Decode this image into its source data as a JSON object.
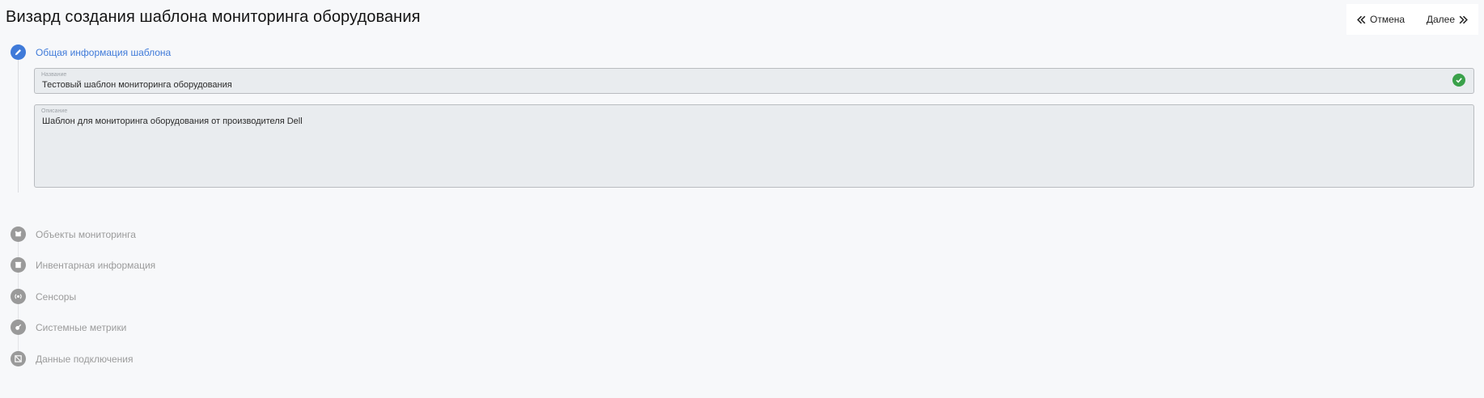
{
  "page": {
    "title": "Визард создания шаблона мониторинга оборудования"
  },
  "actions": {
    "cancel_label": "Отмена",
    "next_label": "Далее"
  },
  "steps": [
    {
      "label": "Общая информация шаблона",
      "icon": "pencil-icon",
      "active": true
    },
    {
      "label": "Объекты мониторинга",
      "icon": "objects-icon",
      "active": false
    },
    {
      "label": "Инвентарная информация",
      "icon": "inventory-icon",
      "active": false
    },
    {
      "label": "Сенсоры",
      "icon": "sensor-icon",
      "active": false
    },
    {
      "label": "Системные метрики",
      "icon": "metrics-icon",
      "active": false
    },
    {
      "label": "Данные подключения",
      "icon": "connection-icon",
      "active": false
    }
  ],
  "form": {
    "name": {
      "label": "Название",
      "value": "Тестовый шаблон мониторинга оборудования",
      "valid": true
    },
    "description": {
      "label": "Описание",
      "value": "Шаблон для мониторинга оборудования от производителя Dell"
    }
  },
  "colors": {
    "accent": "#3f7ad9",
    "inactive": "#9a9a9a",
    "success": "#3aa14a",
    "field_bg": "#e9ecef"
  }
}
